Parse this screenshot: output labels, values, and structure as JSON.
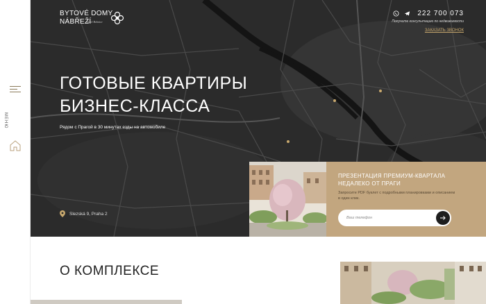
{
  "brand": {
    "line1": "BYTOVÉ DOMY",
    "line2": "NÁBŘEŽÍ",
    "sub": "Staré Bohnice"
  },
  "nav": {
    "menu_label": "МЕНЮ"
  },
  "contacts": {
    "phone": "222 700 073",
    "consult": "Получите консультацию по недвижимости",
    "call_link": "ЗАКАЗАТЬ ЗВОНОК"
  },
  "hero": {
    "title_line1": "ГОТОВЫЕ КВАРТИРЫ",
    "title_line2": "БИЗНЕС-КЛАССА",
    "subtitle": "Рядом с Прагой в 30 минутах езды на автомобиле",
    "address": "Slezská 9, Praha 2"
  },
  "promo": {
    "title": "ПРЕЗЕНТАЦИЯ ПРЕМИУМ-КВАРТАЛА НЕДАЛЕКО ОТ ПРАГИ",
    "text": "Запросите PDF буклет с подробными планировками и описанием в один клик.",
    "input_placeholder": "Ваш телефон"
  },
  "about": {
    "title": "О КОМПЛЕКСЕ"
  },
  "colors": {
    "accent": "#c9a96e",
    "promo_bg": "#c2a67f",
    "hero_bg": "#2a2a2a"
  }
}
